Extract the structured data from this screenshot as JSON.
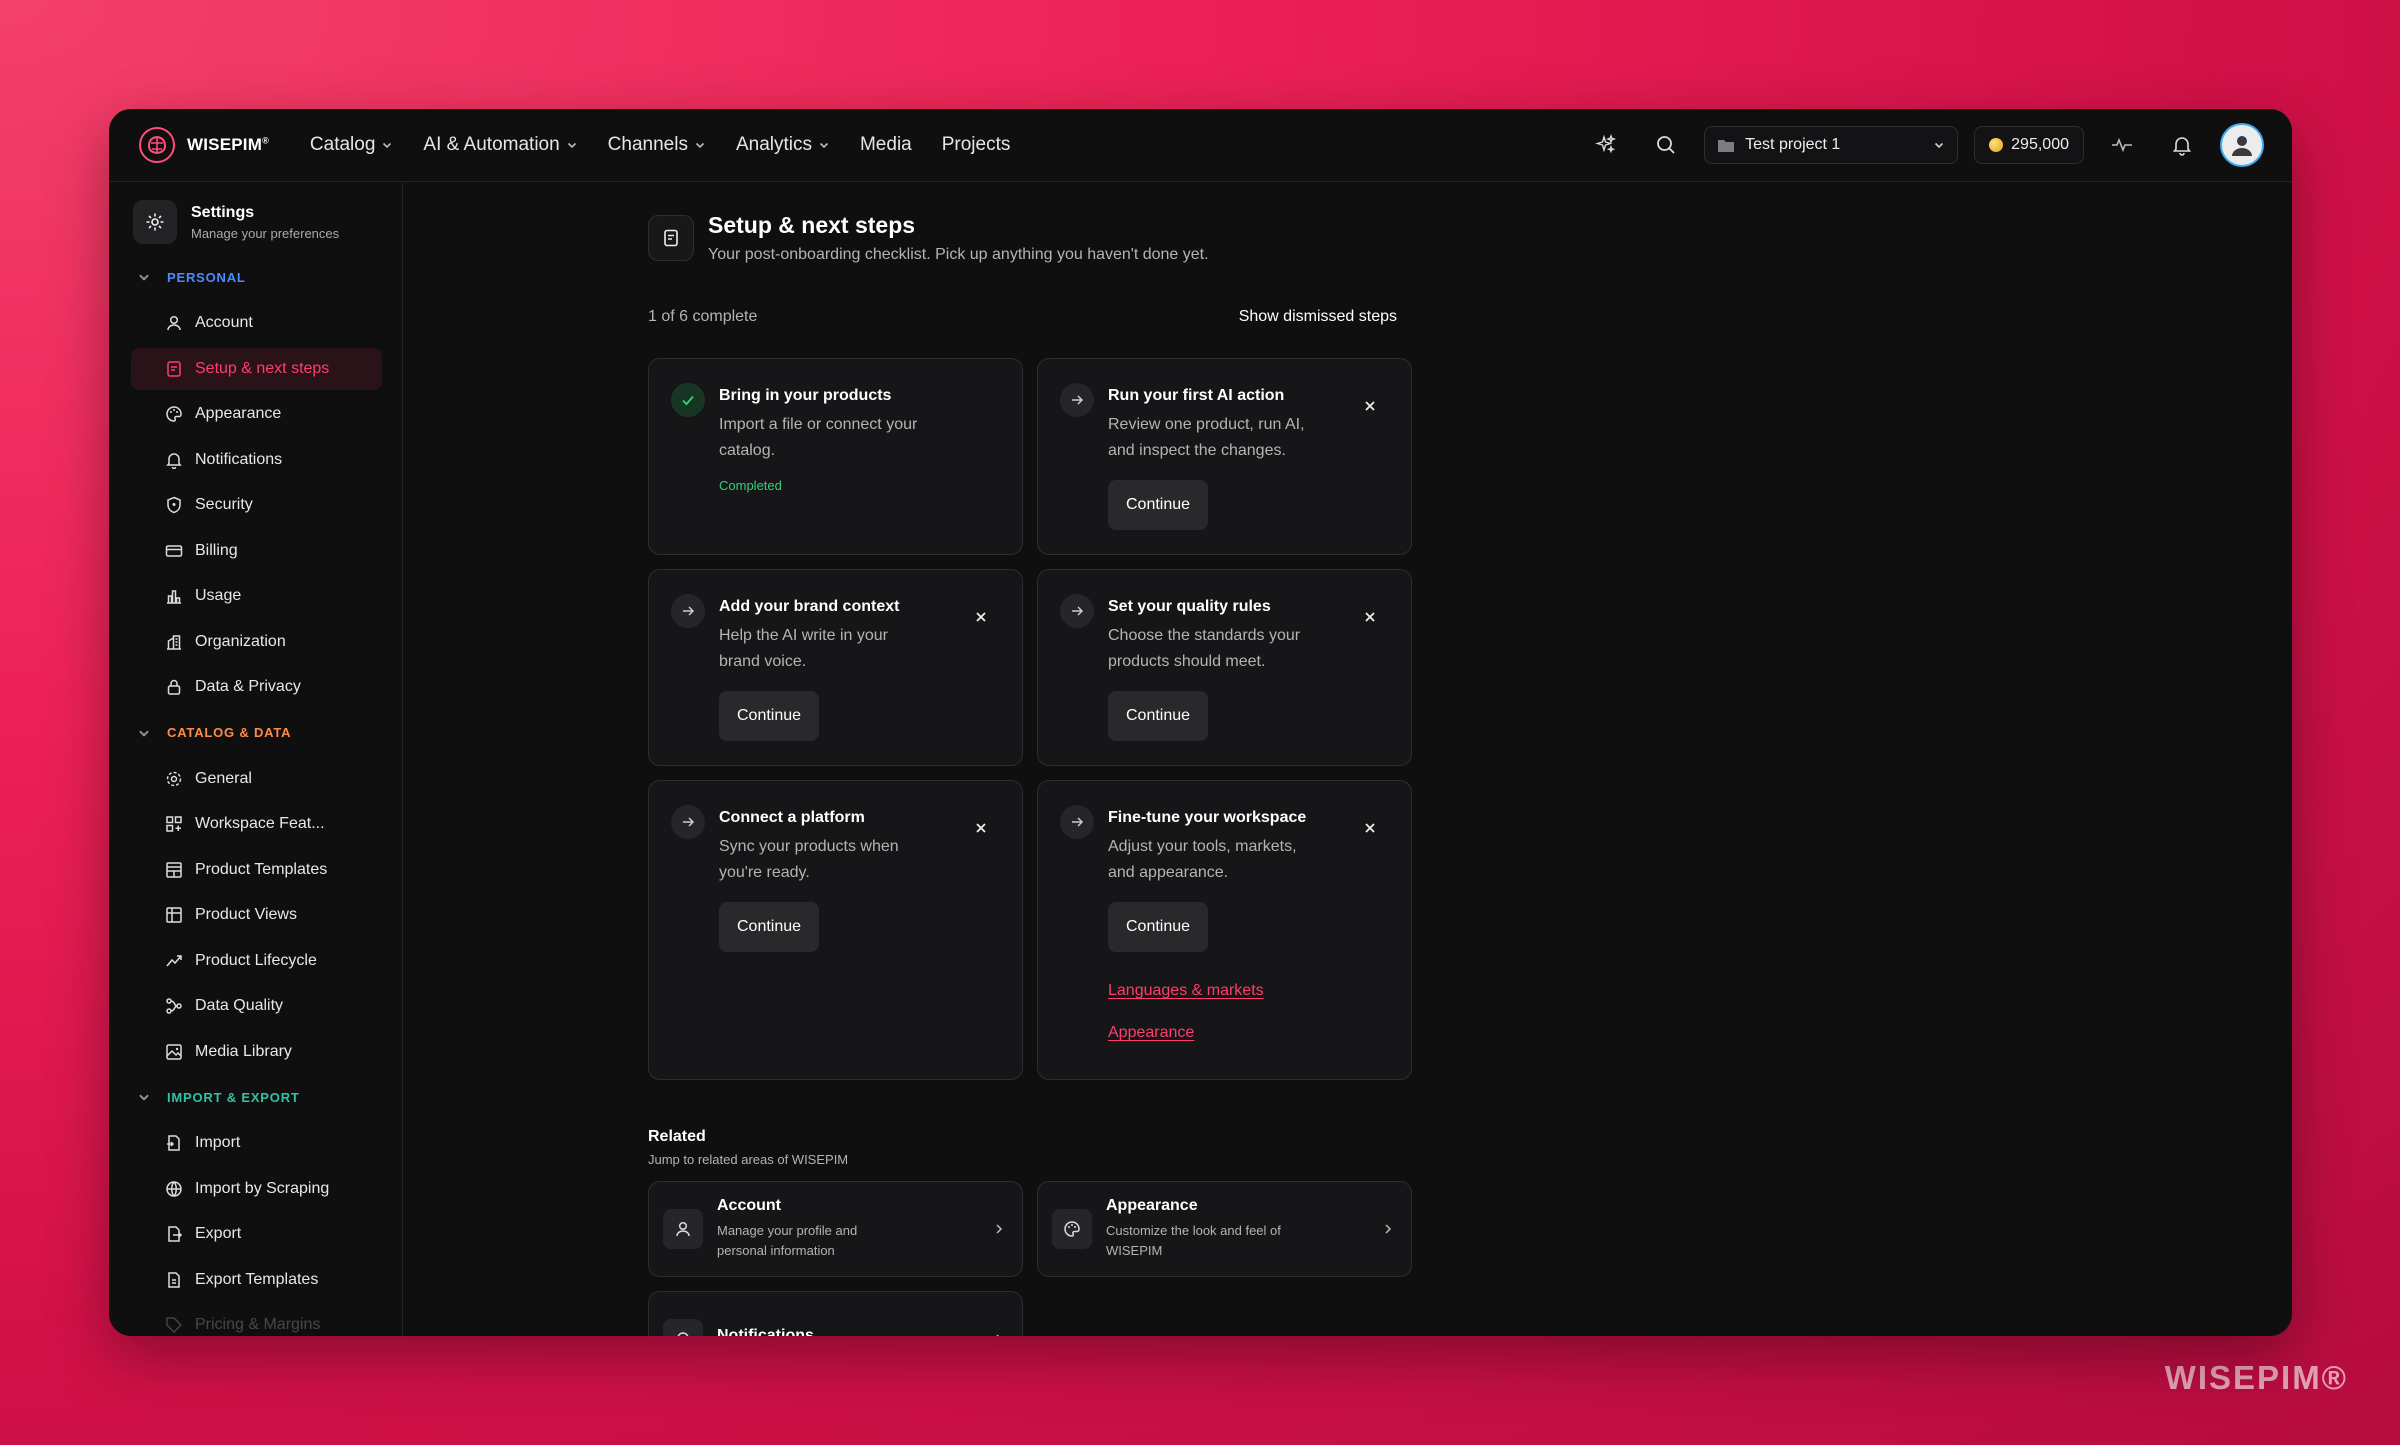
{
  "app": {
    "logo_text": "WISEPIM",
    "logo_mark": "®",
    "watermark": "WISEPIM®"
  },
  "nav": {
    "items": [
      {
        "label": "Catalog",
        "dropdown": true
      },
      {
        "label": "AI & Automation",
        "dropdown": true
      },
      {
        "label": "Channels",
        "dropdown": true
      },
      {
        "label": "Analytics",
        "dropdown": true
      },
      {
        "label": "Media",
        "dropdown": false
      },
      {
        "label": "Projects",
        "dropdown": false
      }
    ],
    "project": "Test project 1",
    "credits": "295,000"
  },
  "sidebar": {
    "title": "Settings",
    "subtitle": "Manage your preferences",
    "sections": [
      {
        "label": "PERSONAL",
        "color": "#4a8cff",
        "items": [
          {
            "label": "Account",
            "icon": "user-icon"
          },
          {
            "label": "Setup & next steps",
            "icon": "checklist-icon",
            "active": true
          },
          {
            "label": "Appearance",
            "icon": "palette-icon"
          },
          {
            "label": "Notifications",
            "icon": "bell-icon"
          },
          {
            "label": "Security",
            "icon": "shield-icon"
          },
          {
            "label": "Billing",
            "icon": "credit-card-icon"
          },
          {
            "label": "Usage",
            "icon": "bar-chart-icon"
          },
          {
            "label": "Organization",
            "icon": "building-icon"
          },
          {
            "label": "Data & Privacy",
            "icon": "lock-icon"
          }
        ]
      },
      {
        "label": "CATALOG & DATA",
        "color": "#ff8a4c",
        "items": [
          {
            "label": "General",
            "icon": "gear-icon"
          },
          {
            "label": "Workspace Feat...",
            "icon": "grid-plus-icon"
          },
          {
            "label": "Product Templates",
            "icon": "template-icon"
          },
          {
            "label": "Product Views",
            "icon": "table-icon"
          },
          {
            "label": "Product Lifecycle",
            "icon": "trend-icon"
          },
          {
            "label": "Data Quality",
            "icon": "flow-icon"
          },
          {
            "label": "Media Library",
            "icon": "image-icon"
          }
        ]
      },
      {
        "label": "IMPORT & EXPORT",
        "color": "#2ec4a6",
        "items": [
          {
            "label": "Import",
            "icon": "file-import-icon"
          },
          {
            "label": "Import by Scraping",
            "icon": "globe-icon"
          },
          {
            "label": "Export",
            "icon": "file-export-icon"
          },
          {
            "label": "Export Templates",
            "icon": "file-template-icon"
          },
          {
            "label": "Pricing & Margins",
            "icon": "tag-icon"
          }
        ]
      }
    ]
  },
  "page": {
    "title": "Setup & next steps",
    "subtitle": "Your post-onboarding checklist. Pick up anything you haven't done yet.",
    "progress_text": "1 of 6 complete",
    "progress": {
      "done": 1,
      "total": 6
    },
    "show_dismissed": "Show dismissed steps"
  },
  "steps": [
    {
      "title": "Bring in your products",
      "desc": "Import a file or connect your catalog.",
      "status": "Completed",
      "done": true
    },
    {
      "title": "Run your first AI action",
      "desc": "Review one product, run AI, and inspect the changes.",
      "button": "Continue"
    },
    {
      "title": "Add your brand context",
      "desc": "Help the AI write in your brand voice.",
      "button": "Continue"
    },
    {
      "title": "Set your quality rules",
      "desc": "Choose the standards your products should meet.",
      "button": "Continue"
    },
    {
      "title": "Connect a platform",
      "desc": "Sync your products when you're ready.",
      "button": "Continue"
    },
    {
      "title": "Fine-tune your workspace",
      "desc": "Adjust your tools, markets, and appearance.",
      "button": "Continue",
      "links": [
        "Languages & markets",
        "Appearance"
      ]
    }
  ],
  "related": {
    "title": "Related",
    "subtitle": "Jump to related areas of WISEPIM",
    "items": [
      {
        "title": "Account",
        "desc": "Manage your profile and personal information",
        "icon": "user-icon"
      },
      {
        "title": "Appearance",
        "desc": "Customize the look and feel of WISEPIM",
        "icon": "palette-icon"
      },
      {
        "title": "Notifications",
        "desc": "",
        "icon": "bell-icon"
      }
    ]
  },
  "colors": {
    "accent": "#ff3d6d",
    "success": "#35d07f",
    "background": "#0f0f10"
  }
}
